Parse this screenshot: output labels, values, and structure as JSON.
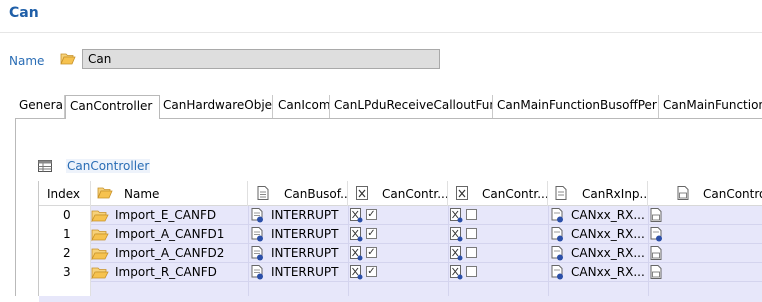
{
  "header": {
    "title": "Can"
  },
  "name_field": {
    "label": "Name",
    "value": "Can"
  },
  "tabs": [
    {
      "label": "General"
    },
    {
      "label": "CanController"
    },
    {
      "label": "CanHardwareObject"
    },
    {
      "label": "CanIcom"
    },
    {
      "label": "CanLPduReceiveCalloutFunc"
    },
    {
      "label": "CanMainFunctionBusoffPerio"
    },
    {
      "label": "CanMainFunctionW"
    }
  ],
  "section": {
    "title": "CanController"
  },
  "table": {
    "columns": [
      {
        "label": "Index"
      },
      {
        "label": "Name",
        "icon": "folder-icon"
      },
      {
        "label": "CanBusof...",
        "icon": "document-icon"
      },
      {
        "label": "CanContr...",
        "icon": "boolean-icon"
      },
      {
        "label": "CanContr...",
        "icon": "boolean-icon"
      },
      {
        "label": "CanRxInp...",
        "icon": "reference-icon"
      },
      {
        "label": "CanControl",
        "icon": "numeric-icon"
      }
    ],
    "rows": [
      {
        "index": "0",
        "name": "Import_E_CANFD",
        "busoff": "INTERRUPT",
        "contr1": "✓",
        "contr2": "",
        "rxinput": "CANxx_RX...",
        "control_icon": "numeric-icon"
      },
      {
        "index": "1",
        "name": "Import_A_CANFD1",
        "busoff": "INTERRUPT",
        "contr1": "✓",
        "contr2": "",
        "rxinput": "CANxx_RX...",
        "control_icon": "reference-icon"
      },
      {
        "index": "2",
        "name": "Import_A_CANFD2",
        "busoff": "INTERRUPT",
        "contr1": "✓",
        "contr2": "",
        "rxinput": "CANxx_RX...",
        "control_icon": "numeric-icon"
      },
      {
        "index": "3",
        "name": "Import_R_CANFD",
        "busoff": "INTERRUPT",
        "contr1": "✓",
        "contr2": "",
        "rxinput": "CANxx_RX...",
        "control_icon": "numeric-icon"
      }
    ]
  },
  "colors": {
    "accent": "#2a6db5",
    "row_bg": "#e7e7fa",
    "folder": "#f0b93a"
  }
}
